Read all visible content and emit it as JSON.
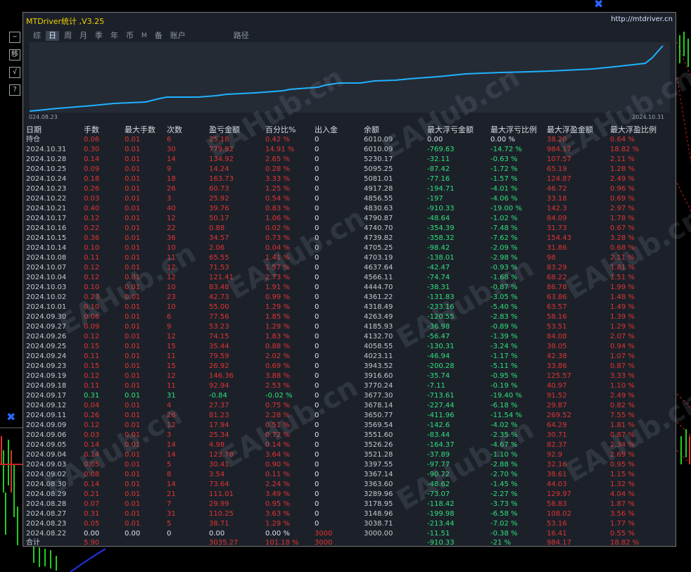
{
  "panel": {
    "title": "MTDriver统计 ,V3.25",
    "url": "http://mtdriver.cn",
    "tabs": [
      "综",
      "日",
      "周",
      "月",
      "季",
      "年",
      "币",
      "M",
      "备",
      "账户",
      "路径"
    ],
    "selected_tab": "日",
    "date_start": "024.08.23",
    "date_end": "2024.10.31",
    "watermark": "EAHub.cn"
  },
  "left_tools": [
    "−",
    "移",
    "√",
    "?"
  ],
  "colors": {
    "profit": "#e03333",
    "loss": "#2fe07d",
    "curve": "#1fb2ff",
    "title": "#f0d000",
    "accent": "#2a66ff"
  },
  "columns": [
    "日期",
    "手数",
    "最大手数",
    "次数",
    "盈亏金额",
    "百分比%",
    "出入金",
    "余额",
    "最大浮亏金额",
    "最大浮亏比例",
    "最大浮盈金额",
    "最大浮盈比例"
  ],
  "rows": [
    [
      "持仓",
      "0.06",
      "0.01",
      "6",
      "25.18",
      "0.42 %",
      "0",
      "6010.09",
      "0.00",
      "0.00 %",
      "38.20",
      "0.64 %"
    ],
    [
      "2024.10.31",
      "0.30",
      "0.01",
      "30",
      "779.92",
      "14.91 %",
      "0",
      "6010.09",
      "-769.63",
      "-14.72 %",
      "984.17",
      "18.82 %"
    ],
    [
      "2024.10.28",
      "0.14",
      "0.01",
      "14",
      "134.92",
      "2.65 %",
      "0",
      "5230.17",
      "-32.11",
      "-0.63 %",
      "107.57",
      "2.11 %"
    ],
    [
      "2024.10.25",
      "0.09",
      "0.01",
      "9",
      "14.24",
      "0.28 %",
      "0",
      "5095.25",
      "-87.42",
      "-1.72 %",
      "65.19",
      "1.28 %"
    ],
    [
      "2024.10.24",
      "0.18",
      "0.01",
      "18",
      "163.73",
      "3.33 %",
      "0",
      "5081.01",
      "-77.16",
      "-1.57 %",
      "124.87",
      "2.49 %"
    ],
    [
      "2024.10.23",
      "0.26",
      "0.01",
      "26",
      "60.73",
      "1.25 %",
      "0",
      "4917.28",
      "-194.71",
      "-4.01 %",
      "46.72",
      "0.96 %"
    ],
    [
      "2024.10.22",
      "0.03",
      "0.01",
      "3",
      "25.92",
      "0.54 %",
      "0",
      "4856.55",
      "-197",
      "-4.06 %",
      "33.18",
      "0.69 %"
    ],
    [
      "2024.10.21",
      "0.40",
      "0.01",
      "40",
      "39.76",
      "0.83 %",
      "0",
      "4830.63",
      "-910.33",
      "-19.00 %",
      "142.3",
      "2.97 %"
    ],
    [
      "2024.10.17",
      "0.12",
      "0.01",
      "12",
      "50.17",
      "1.06 %",
      "0",
      "4790.87",
      "-48.64",
      "-1.02 %",
      "84.09",
      "1.78 %"
    ],
    [
      "2024.10.16",
      "0.22",
      "0.01",
      "22",
      "0.88",
      "0.02 %",
      "0",
      "4740.70",
      "-354.39",
      "-7.48 %",
      "31.73",
      "0.67 %"
    ],
    [
      "2024.10.15",
      "0.36",
      "0.01",
      "36",
      "34.57",
      "0.73 %",
      "0",
      "4739.82",
      "-358.32",
      "-7.62 %",
      "154.43",
      "3.28 %"
    ],
    [
      "2024.10.14",
      "0.10",
      "0.01",
      "10",
      "2.06",
      "0.04 %",
      "0",
      "4705.25",
      "-98.42",
      "-2.09 %",
      "31.86",
      "0.68 %"
    ],
    [
      "2024.10.08",
      "0.11",
      "0.01",
      "11",
      "65.55",
      "1.41 %",
      "0",
      "4703.19",
      "-138.01",
      "-2.98 %",
      "98",
      "2.11 %"
    ],
    [
      "2024.10.07",
      "0.12",
      "0.01",
      "12",
      "71.53",
      "1.57 %",
      "0",
      "4637.64",
      "-42.47",
      "-0.93 %",
      "83.29",
      "1.81 %"
    ],
    [
      "2024.10.04",
      "0.12",
      "0.01",
      "12",
      "121.41",
      "2.73 %",
      "0",
      "4566.11",
      "-74.74",
      "-1.68 %",
      "68.22",
      "1.51 %"
    ],
    [
      "2024.10.03",
      "0.10",
      "0.01",
      "10",
      "83.48",
      "1.91 %",
      "0",
      "4444.70",
      "-38.31",
      "-0.87 %",
      "86.78",
      "1.99 %"
    ],
    [
      "2024.10.02",
      "0.23",
      "0.01",
      "23",
      "42.73",
      "0.99 %",
      "0",
      "4361.22",
      "-131.83",
      "-3.05 %",
      "63.86",
      "1.48 %"
    ],
    [
      "2024.10.01",
      "0.10",
      "0.01",
      "10",
      "55.00",
      "1.29 %",
      "0",
      "4318.49",
      "-233.16",
      "-5.40 %",
      "63.57",
      "1.49 %"
    ],
    [
      "2024.09.30",
      "0.06",
      "0.01",
      "6",
      "77.56",
      "1.85 %",
      "0",
      "4263.49",
      "-120.55",
      "-2.83 %",
      "58.16",
      "1.39 %"
    ],
    [
      "2024.09.27",
      "0.09",
      "0.01",
      "9",
      "53.23",
      "1.29 %",
      "0",
      "4185.93",
      "-36.98",
      "-0.89 %",
      "53.51",
      "1.29 %"
    ],
    [
      "2024.09.26",
      "0.12",
      "0.01",
      "12",
      "74.15",
      "1.83 %",
      "0",
      "4132.70",
      "-56.47",
      "-1.39 %",
      "84.08",
      "2.07 %"
    ],
    [
      "2024.09.25",
      "0.15",
      "0.01",
      "15",
      "35.44",
      "0.88 %",
      "0",
      "4058.55",
      "-130.31",
      "-3.24 %",
      "38.05",
      "0.94 %"
    ],
    [
      "2024.09.24",
      "0.11",
      "0.01",
      "11",
      "79.59",
      "2.02 %",
      "0",
      "4023.11",
      "-46.94",
      "-1.17 %",
      "42.38",
      "1.07 %"
    ],
    [
      "2024.09.23",
      "0.15",
      "0.01",
      "15",
      "26.92",
      "0.69 %",
      "0",
      "3943.52",
      "-200.28",
      "-5.11 %",
      "33.86",
      "0.87 %"
    ],
    [
      "2024.09.19",
      "0.12",
      "0.01",
      "12",
      "146.36",
      "3.88 %",
      "0",
      "3916.60",
      "-35.74",
      "-0.95 %",
      "125.57",
      "3.33 %"
    ],
    [
      "2024.09.18",
      "0.11",
      "0.01",
      "11",
      "92.94",
      "2.53 %",
      "0",
      "3770.24",
      "-7.11",
      "-0.19 %",
      "40.97",
      "1.10 %"
    ],
    [
      "2024.09.17",
      "0.31",
      "0.01",
      "31",
      "-0.84",
      "-0.02 %",
      "0",
      "3677.30",
      "-713.61",
      "-19.40 %",
      "91.52",
      "2.49 %"
    ],
    [
      "2024.09.12",
      "0.04",
      "0.01",
      "4",
      "27.37",
      "0.75 %",
      "0",
      "3678.14",
      "-227.44",
      "-6.18 %",
      "29.87",
      "0.82 %"
    ],
    [
      "2024.09.11",
      "0.26",
      "0.01",
      "26",
      "81.23",
      "2.28 %",
      "0",
      "3650.77",
      "-411.96",
      "-11.54 %",
      "269.52",
      "7.55 %"
    ],
    [
      "2024.09.09",
      "0.12",
      "0.01",
      "12",
      "17.94",
      "0.51 %",
      "0",
      "3569.54",
      "-142.6",
      "-4.02 %",
      "64.29",
      "1.81 %"
    ],
    [
      "2024.09.06",
      "0.03",
      "0.01",
      "3",
      "25.34",
      "0.72 %",
      "0",
      "3551.60",
      "-83.44",
      "-2.35 %",
      "30.71",
      "0.87 %"
    ],
    [
      "2024.09.05",
      "0.14",
      "0.01",
      "14",
      "4.98",
      "0.14 %",
      "0",
      "3526.26",
      "-164.37",
      "-4.67 %",
      "82.37",
      "2.34 %"
    ],
    [
      "2024.09.04",
      "0.14",
      "0.01",
      "14",
      "123.78",
      "3.64 %",
      "0",
      "3521.28",
      "-37.89",
      "-1.10 %",
      "92.9",
      "2.69 %"
    ],
    [
      "2024.09.03",
      "0.05",
      "0.01",
      "5",
      "30.41",
      "0.90 %",
      "0",
      "3397.55",
      "-97.77",
      "-2.88 %",
      "32.16",
      "0.95 %"
    ],
    [
      "2024.09.02",
      "0.08",
      "0.01",
      "8",
      "3.54",
      "0.11 %",
      "0",
      "3367.14",
      "-90.72",
      "-2.70 %",
      "38.61",
      "1.15 %"
    ],
    [
      "2024.08.30",
      "0.14",
      "0.01",
      "14",
      "73.64",
      "2.24 %",
      "0",
      "3363.60",
      "-48.62",
      "-1.45 %",
      "44.03",
      "1.32 %"
    ],
    [
      "2024.08.29",
      "0.21",
      "0.01",
      "21",
      "111.01",
      "3.49 %",
      "0",
      "3289.96",
      "-73.07",
      "-2.27 %",
      "129.97",
      "4.04 %"
    ],
    [
      "2024.08.28",
      "0.07",
      "0.01",
      "7",
      "29.99",
      "0.95 %",
      "0",
      "3178.95",
      "-118.42",
      "-3.73 %",
      "58.83",
      "1.87 %"
    ],
    [
      "2024.08.27",
      "0.31",
      "0.01",
      "31",
      "110.25",
      "3.63 %",
      "0",
      "3148.96",
      "-199.98",
      "-6.58 %",
      "108.02",
      "3.56 %"
    ],
    [
      "2024.08.23",
      "0.05",
      "0.01",
      "5",
      "38.71",
      "1.29 %",
      "0",
      "3038.71",
      "-213.44",
      "-7.02 %",
      "53.16",
      "1.77 %"
    ],
    [
      "2024.08.22",
      "0.00",
      "0.00",
      "0",
      "0.00",
      "0.00 %",
      "3000",
      "3000.00",
      "-11.51",
      "-0.38 %",
      "16.41",
      "0.55 %"
    ]
  ],
  "total": [
    "合计",
    "5.90",
    "",
    "",
    "3035.27",
    "101.18 %",
    "3000",
    "",
    "-910.33",
    "-21 %",
    "984.17",
    "18.82 %"
  ]
}
